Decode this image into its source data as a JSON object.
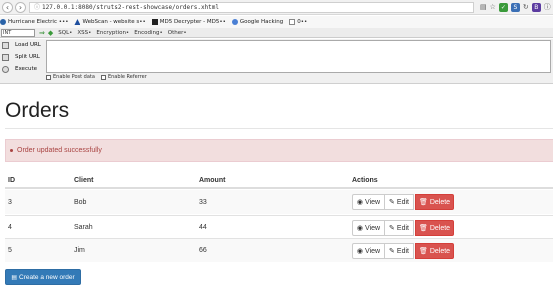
{
  "browser": {
    "url": "127.0.0.1:8080/struts2-rest-showcase/orders.xhtml",
    "bookmarks": [
      {
        "label": "Hurricane Electric •••",
        "icon": "globe-icon"
      },
      {
        "label": "WebScan - website s••",
        "icon": "shield-icon"
      },
      {
        "label": "MD5 Decrypter - MD5••",
        "icon": "md5-icon"
      },
      {
        "label": "Google Hacking",
        "icon": "google-icon"
      },
      {
        "label": "0••",
        "icon": "page-icon"
      }
    ]
  },
  "hackbar": {
    "select_value": "INT",
    "menus": [
      "SQL•",
      "XSS•",
      "Encryption•",
      "Encoding•",
      "Other•"
    ],
    "actions": [
      "Load URL",
      "Split URL",
      "Execute"
    ],
    "checks": [
      "Enable Post data",
      "Enable Referrer"
    ]
  },
  "page": {
    "title": "Orders",
    "alert": "Order updated successfully",
    "create_label": "Create a new order"
  },
  "table": {
    "headers": [
      "ID",
      "Client",
      "Amount",
      "Actions"
    ],
    "rows": [
      {
        "id": "3",
        "client": "Bob",
        "amount": "33"
      },
      {
        "id": "4",
        "client": "Sarah",
        "amount": "44"
      },
      {
        "id": "5",
        "client": "Jim",
        "amount": "66"
      }
    ],
    "view_label": "View",
    "edit_label": "Edit",
    "delete_label": "Delete"
  },
  "colors": {
    "alert_bg": "#f2dede",
    "alert_text": "#a94442",
    "danger": "#d9534f",
    "primary": "#337ab7"
  }
}
